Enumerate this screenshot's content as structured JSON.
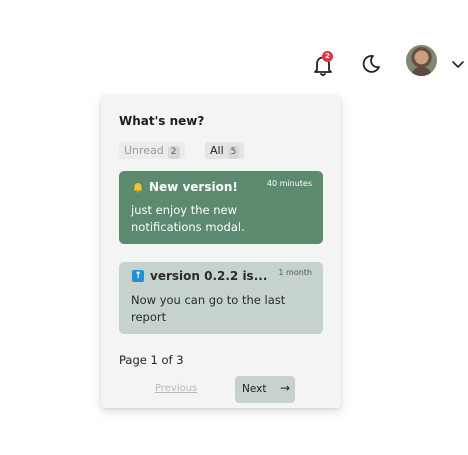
{
  "header": {
    "notification_count": "2",
    "icons": {
      "bell": "bell-icon",
      "theme": "moon-icon",
      "avatar": "user-avatar",
      "menu": "chevron-down-icon"
    }
  },
  "notifications": {
    "title": "What's new?",
    "filters": [
      {
        "label": "Unread",
        "count": "2"
      },
      {
        "label": "All",
        "count": "5"
      }
    ],
    "items": [
      {
        "icon": "bell-emoji-icon",
        "title": "New version!",
        "time": "40 minutes",
        "body": "just enjoy the new notifications modal."
      },
      {
        "icon": "up-arrow-icon",
        "title": "version 0.2.2 is...",
        "time": "1 month",
        "body": "Now you can go to the last report"
      }
    ],
    "pagination": {
      "info": "Page 1 of 3",
      "previous": "Previous",
      "next": "Next",
      "next_arrow": "→"
    }
  },
  "colors": {
    "card_active": "#5b8a6e",
    "card_inactive": "#c5d3cc",
    "badge": "#e3343f"
  }
}
